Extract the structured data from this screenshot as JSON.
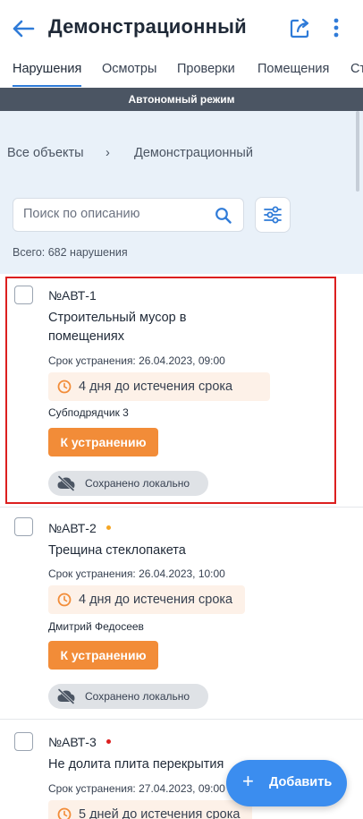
{
  "header": {
    "title": "Демонстрационный",
    "back_icon": "arrow-left-icon",
    "share_icon": "share-icon",
    "more_icon": "more-vertical-icon"
  },
  "tabs": [
    {
      "label": "Нарушения",
      "active": true
    },
    {
      "label": "Осмотры",
      "active": false
    },
    {
      "label": "Проверки",
      "active": false
    },
    {
      "label": "Помещения",
      "active": false
    },
    {
      "label": "Ст",
      "active": false
    }
  ],
  "offline_banner": "Автономный режим",
  "breadcrumb": {
    "root": "Все объекты",
    "separator": "›",
    "current": "Демонстрационный"
  },
  "search": {
    "placeholder": "Поиск по описанию",
    "value": ""
  },
  "total_text": "Всего: 682 нарушения",
  "cards": [
    {
      "number": "№АВТ-1",
      "description_lines": [
        "Строительный мусор в",
        "помещениях"
      ],
      "deadline": "Срок устранения: 26.04.2023, 09:00",
      "countdown": "4 дня до истечения срока",
      "assignee": "Субподрядчик 3",
      "status_button": "К устранению",
      "saved_label": "Сохранено локально",
      "priority_dot": null
    },
    {
      "number": "№АВТ-2",
      "description_lines": [
        "Трещина стеклопакета"
      ],
      "deadline": "Срок устранения: 26.04.2023, 10:00",
      "countdown": "4 дня до истечения срока",
      "assignee": "Дмитрий Федосеев",
      "status_button": "К устранению",
      "saved_label": "Сохранено локально",
      "priority_dot": "#f5a623"
    },
    {
      "number": "№АВТ-3",
      "description_lines": [
        "Не долита плита перекрытия"
      ],
      "deadline": "Срок устранения: 27.04.2023, 09:00",
      "countdown": "5 дней до истечения срока",
      "assignee": "",
      "status_button": "",
      "saved_label": "",
      "priority_dot": "#dc1f1f"
    }
  ],
  "fab": {
    "label": "Добавить",
    "icon": "+"
  },
  "colors": {
    "accent": "#3b8def",
    "status_orange": "#f28c38",
    "highlight_red": "#dc1f1f"
  }
}
